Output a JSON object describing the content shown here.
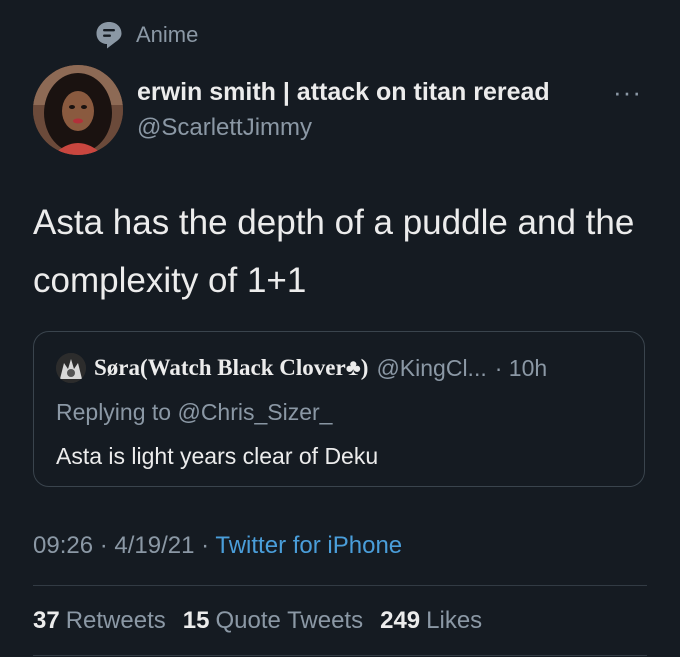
{
  "topic": {
    "label": "Anime",
    "icon": "topic-tag-icon"
  },
  "author": {
    "name": "erwin smith | attack on titan reread",
    "handle": "@ScarlettJimmy",
    "more_label": "···"
  },
  "tweet": {
    "text": "Asta has the depth of a puddle and the complexity of 1+1"
  },
  "quoted": {
    "name": "Søra(Watch Black Clover♣)",
    "handle": "@KingCl...",
    "time": "· 10h",
    "replying_prefix": "Replying to ",
    "replying_to": "@Chris_Sizer_",
    "text": "Asta is light years clear of Deku"
  },
  "meta": {
    "time": "09:26",
    "sep1": "·",
    "date": "4/19/21",
    "sep2": "·",
    "source": "Twitter for iPhone"
  },
  "stats": {
    "retweets_count": "37",
    "retweets_label": "Retweets",
    "quotes_count": "15",
    "quotes_label": "Quote Tweets",
    "likes_count": "249",
    "likes_label": "Likes"
  },
  "colors": {
    "background": "#151b22",
    "accent": "#4a9eda",
    "muted": "#8b98a5"
  }
}
